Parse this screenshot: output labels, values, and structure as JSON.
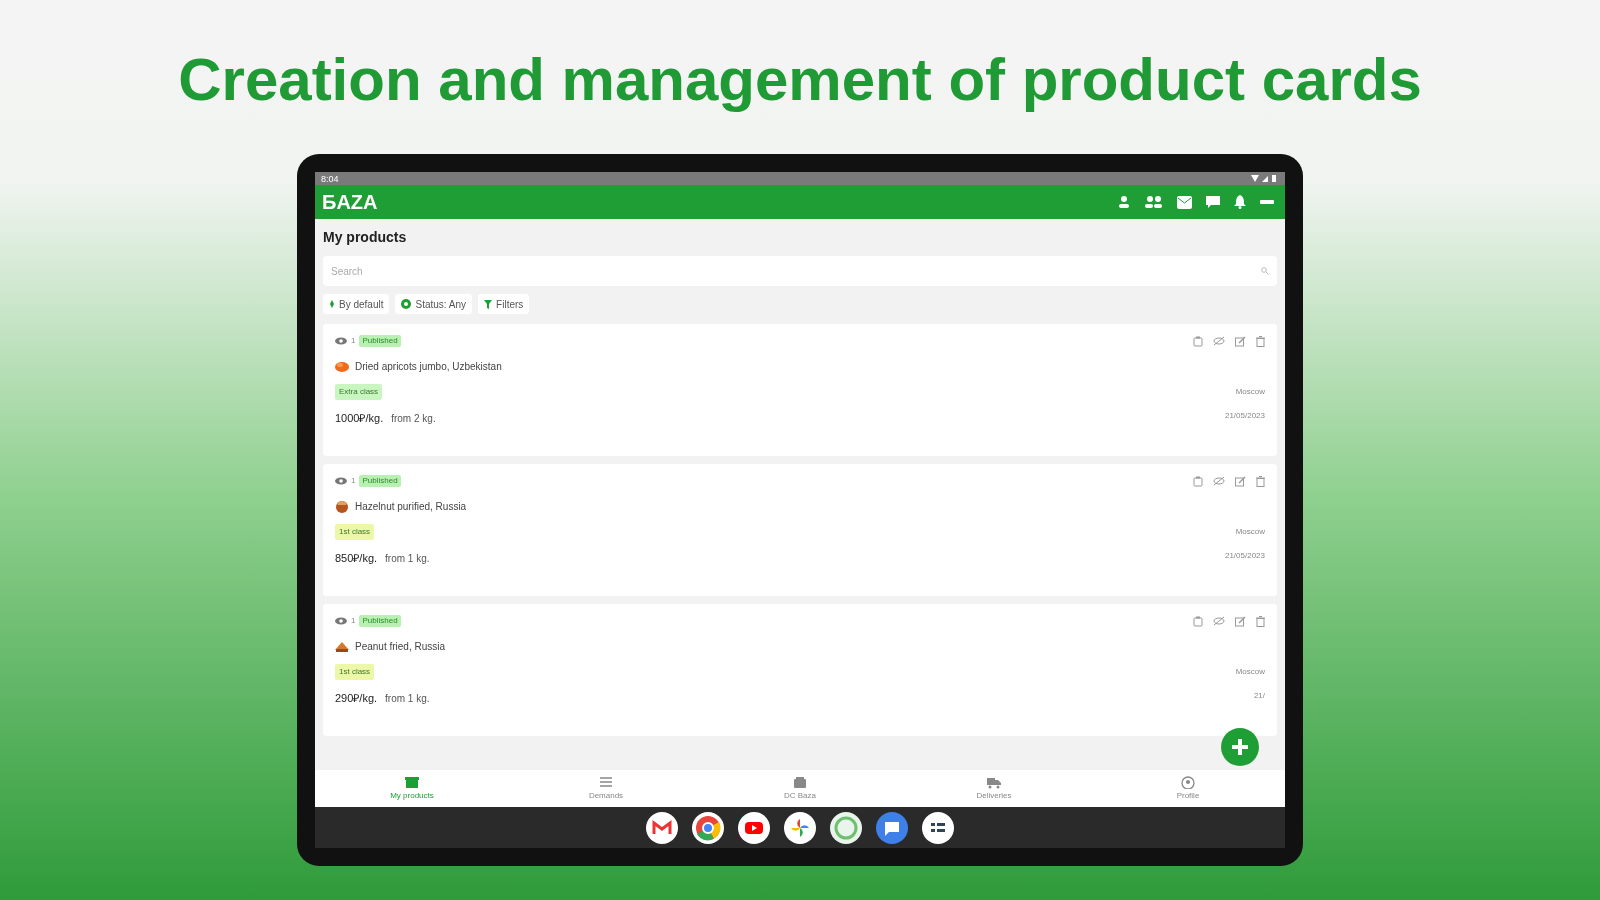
{
  "headline": "Creation and management of product cards",
  "status_bar": {
    "time": "8:04"
  },
  "app_bar": {
    "title": "БAZA"
  },
  "page_title": "My products",
  "search": {
    "placeholder": "Search"
  },
  "chips": [
    {
      "label": "By default",
      "kind": "sort"
    },
    {
      "label": "Status: Any",
      "kind": "status"
    },
    {
      "label": "Filters",
      "kind": "filter"
    }
  ],
  "products": [
    {
      "views": "1",
      "status": "Published",
      "kind": "apricot",
      "name": "Dried apricots jumbo, Uzbekistan",
      "grade": "Extra class",
      "color": "#c9f5c0",
      "price": "1000₽/kg.",
      "min_order": "from 2 kg.",
      "city": "Moscow",
      "date": "21/05/2023"
    },
    {
      "views": "1",
      "status": "Published",
      "kind": "hazelnut",
      "name": "Hazelnut purified, Russia",
      "grade": "1st class",
      "color": "#ecf8a8",
      "price": "850₽/kg.",
      "min_order": "from 1 kg.",
      "city": "Moscow",
      "date": "21/05/2023"
    },
    {
      "views": "1",
      "status": "Published",
      "kind": "peanut",
      "name": "Peanut fried, Russia",
      "grade": "1st class",
      "color": "#ecf8a8",
      "price": "290₽/kg.",
      "min_order": "from 1 kg.",
      "city": "Moscow",
      "date": "21/"
    }
  ],
  "bottom_nav": [
    {
      "label": "My products",
      "kind": "store",
      "selected": true
    },
    {
      "label": "Demands",
      "kind": "list",
      "selected": false
    },
    {
      "label": "DC Baza",
      "kind": "shop",
      "selected": false
    },
    {
      "label": "Deliveries",
      "kind": "truck",
      "selected": false
    },
    {
      "label": "Profile",
      "kind": "profile",
      "selected": false
    }
  ]
}
